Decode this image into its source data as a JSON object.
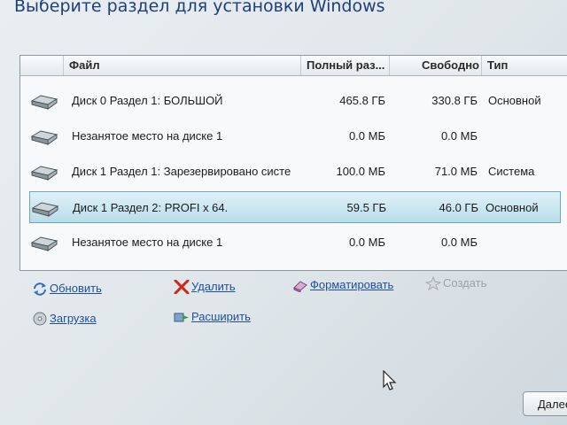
{
  "window": {
    "title": "Выберите раздел для установки Windows"
  },
  "table": {
    "headers": {
      "file": "Файл",
      "total_size": "Полный раз...",
      "free": "Свободно",
      "type": "Тип"
    },
    "rows": [
      {
        "name": "Диск 0 Раздел 1: БОЛЬШОЙ",
        "total_size": "465.8 ГБ",
        "free": "330.8 ГБ",
        "type": "Основной",
        "icon": "disk-icon",
        "selected": false
      },
      {
        "name": "Незанятое место на диске 1",
        "total_size": "0.0 МБ",
        "free": "0.0 МБ",
        "type": "",
        "icon": "disk-icon",
        "selected": false
      },
      {
        "name": "Диск 1 Раздел 1: Зарезервировано систе",
        "total_size": "100.0 МБ",
        "free": "71.0 МБ",
        "type": "Система",
        "icon": "disk-icon",
        "selected": false
      },
      {
        "name": "Диск 1 Раздел 2: PROFI x 64.",
        "total_size": "59.5 ГБ",
        "free": "46.0 ГБ",
        "type": "Основной",
        "icon": "disk-icon",
        "selected": true
      },
      {
        "name": "Незанятое место на диске 1",
        "total_size": "0.0 МБ",
        "free": "0.0 МБ",
        "type": "",
        "icon": "disk-icon",
        "selected": false
      }
    ]
  },
  "actions": {
    "refresh": {
      "label": "Обновить",
      "icon": "refresh-icon"
    },
    "delete": {
      "label": "Удалить",
      "icon": "delete-icon"
    },
    "format": {
      "label": "Форматировать",
      "icon": "eraser-icon"
    },
    "create": {
      "label": "Создать",
      "icon": "star-icon"
    },
    "load": {
      "label": "Загрузка",
      "icon": "cd-icon"
    },
    "extend": {
      "label": "Расширить",
      "icon": "extend-icon"
    }
  },
  "footer": {
    "next_label": "Далее"
  },
  "colors": {
    "accent": "#1f4f9b",
    "title": "#1f3f7a",
    "selection": "#b9dde9"
  }
}
